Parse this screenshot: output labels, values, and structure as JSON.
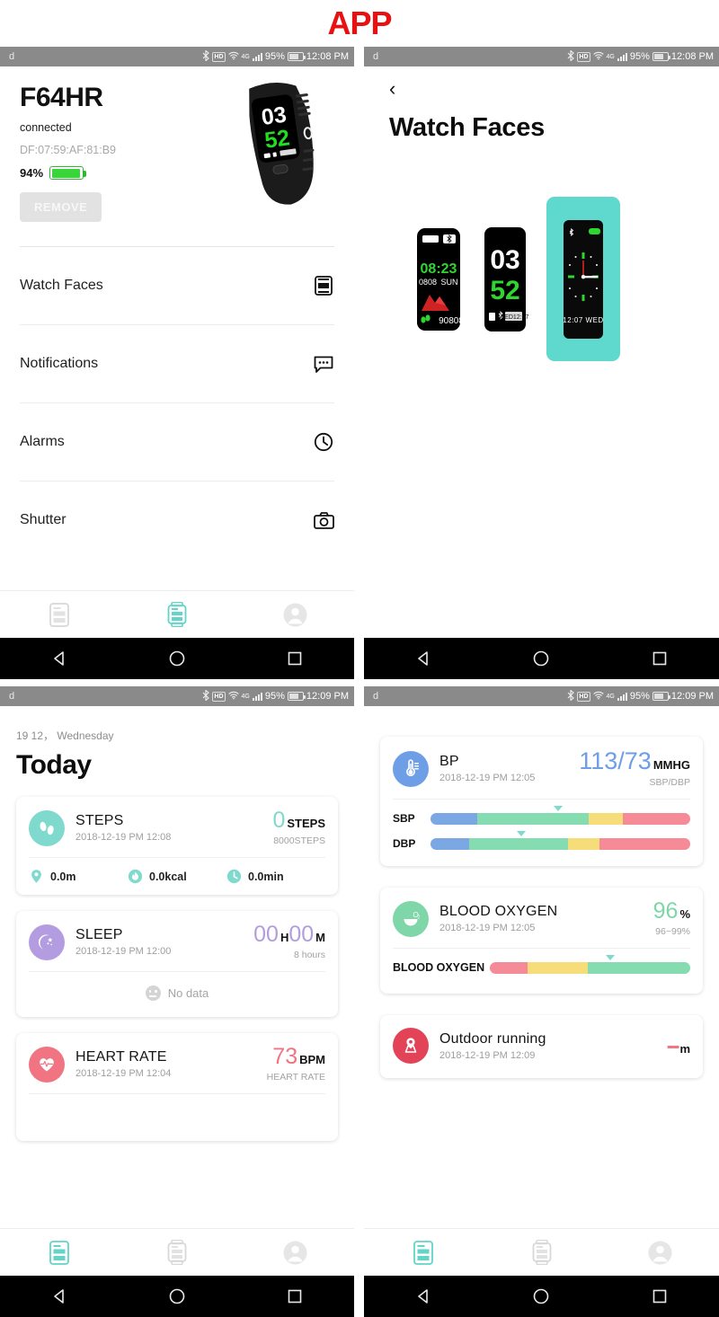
{
  "title": "APP",
  "accent": "#62d4c8",
  "title_color": "#e81010",
  "statusbar": {
    "carrier": "d",
    "battery_pct": "95%",
    "time_a": "12:08 PM",
    "time_b": "12:09 PM",
    "icons": [
      "bluetooth-icon",
      "hd-icon",
      "wifi-icon",
      "4g-signal-icon",
      "battery-icon"
    ],
    "network": "4G"
  },
  "panel1": {
    "device_name": "F64HR",
    "status": "connected",
    "mac": "DF:07:59:AF:81:B9",
    "battery": "94%",
    "remove_label": "REMOVE",
    "menu": [
      {
        "label": "Watch Faces",
        "icon": "watch-face-icon"
      },
      {
        "label": "Notifications",
        "icon": "message-bubble-icon"
      },
      {
        "label": "Alarms",
        "icon": "clock-icon"
      },
      {
        "label": "Shutter",
        "icon": "camera-icon"
      }
    ],
    "device_face": {
      "hour": "03",
      "minute": "52"
    },
    "tabs": [
      {
        "name": "tab-data",
        "icon": "data-card-icon",
        "active": false
      },
      {
        "name": "tab-device",
        "icon": "watch-icon",
        "active": true
      },
      {
        "name": "tab-profile",
        "icon": "person-icon",
        "active": false
      }
    ]
  },
  "panel2": {
    "back": "‹",
    "title": "Watch Faces",
    "faces": [
      {
        "name": "face-mountain",
        "selected": false,
        "time": "08:23",
        "date": "0808",
        "weekday": "SUN",
        "steps": "90808"
      },
      {
        "name": "face-bigdigits",
        "selected": false,
        "hour": "03",
        "minute": "52",
        "date": "WED 12:07"
      },
      {
        "name": "face-analog",
        "selected": true,
        "date": "12:07 WED"
      }
    ],
    "tabs": [
      {
        "name": "tab-data",
        "icon": "data-card-icon",
        "active": false
      },
      {
        "name": "tab-device",
        "icon": "watch-icon",
        "active": true
      },
      {
        "name": "tab-profile",
        "icon": "person-icon",
        "active": false
      }
    ]
  },
  "panel3": {
    "date_line": "19 12， Wednesday",
    "heading": "Today",
    "cards": [
      {
        "name": "steps-card",
        "icon": "footsteps-icon",
        "icon_color": "#7fd9cd",
        "title": "STEPS",
        "time": "2018-12-19 PM 12:08",
        "value": "0",
        "value_color": "#7fd9cd",
        "unit": "STEPS",
        "sub": "8000STEPS",
        "stats": [
          {
            "icon": "location-pin-icon",
            "text": "0.0m"
          },
          {
            "icon": "flame-icon",
            "text": "0.0kcal"
          },
          {
            "icon": "clock-icon",
            "text": "0.0min"
          }
        ]
      },
      {
        "name": "sleep-card",
        "icon": "moon-stars-icon",
        "icon_color": "#b39ce0",
        "title": "SLEEP",
        "time": "2018-12-19 PM 12:00",
        "hours": "00",
        "hours_unit": "H",
        "minutes": "00",
        "minutes_unit": "M",
        "value_color": "#b39ce0",
        "sub": "8 hours",
        "empty_text": "No data"
      },
      {
        "name": "heart-rate-card",
        "icon": "heart-pulse-icon",
        "icon_color": "#f07481",
        "title": "HEART RATE",
        "time": "2018-12-19 PM 12:04",
        "value": "73",
        "value_color": "#f07481",
        "unit": "BPM",
        "sub": "HEART RATE"
      }
    ],
    "tabs": [
      {
        "name": "tab-data",
        "icon": "data-card-icon",
        "active": true
      },
      {
        "name": "tab-device",
        "icon": "watch-icon",
        "active": false
      },
      {
        "name": "tab-profile",
        "icon": "person-icon",
        "active": false
      }
    ]
  },
  "panel4": {
    "cards": [
      {
        "name": "bp-card",
        "icon": "thermometer-icon",
        "icon_color": "#6d9ee6",
        "title": "BP",
        "time": "2018-12-19 PM 12:05",
        "value": "113/73",
        "value_color": "#6d9ee6",
        "unit": "MMHG",
        "sub": "SBP/DBP",
        "gauges": [
          {
            "label": "SBP",
            "marker_pct": 49,
            "segments": [
              {
                "color": "#7ba7e3",
                "pct": 18
              },
              {
                "color": "#84dcb0",
                "pct": 43
              },
              {
                "color": "#f7dd79",
                "pct": 13
              },
              {
                "color": "#f58b97",
                "pct": 26
              }
            ]
          },
          {
            "label": "DBP",
            "marker_pct": 35,
            "segments": [
              {
                "color": "#7ba7e3",
                "pct": 15
              },
              {
                "color": "#84dcb0",
                "pct": 38
              },
              {
                "color": "#f7dd79",
                "pct": 12
              },
              {
                "color": "#f58b97",
                "pct": 35
              }
            ]
          }
        ]
      },
      {
        "name": "blood-oxygen-card",
        "icon": "o2-drop-icon",
        "icon_color": "#7fd6a8",
        "title": "BLOOD OXYGEN",
        "time": "2018-12-19 PM 12:05",
        "value": "96",
        "value_color": "#7fd6a8",
        "unit": "%",
        "sub": "96~99%",
        "gauges": [
          {
            "label": "BLOOD OXYGEN",
            "marker_pct": 60,
            "segments": [
              {
                "color": "#f58b97",
                "pct": 19
              },
              {
                "color": "#f7dd79",
                "pct": 30
              },
              {
                "color": "#84dcb0",
                "pct": 51
              }
            ]
          }
        ]
      },
      {
        "name": "outdoor-running-card",
        "icon": "running-map-pin-icon",
        "icon_color": "#e24356",
        "title": "Outdoor running",
        "time": "2018-12-19 PM 12:09",
        "value": "--",
        "value_color": "#f07481",
        "unit": "m"
      }
    ],
    "tabs": [
      {
        "name": "tab-data",
        "icon": "data-card-icon",
        "active": true
      },
      {
        "name": "tab-device",
        "icon": "watch-icon",
        "active": false
      },
      {
        "name": "tab-profile",
        "icon": "person-icon",
        "active": false
      }
    ]
  },
  "navbar": {
    "back": "back-triangle-icon",
    "home": "home-circle-icon",
    "recents": "recents-square-icon"
  }
}
